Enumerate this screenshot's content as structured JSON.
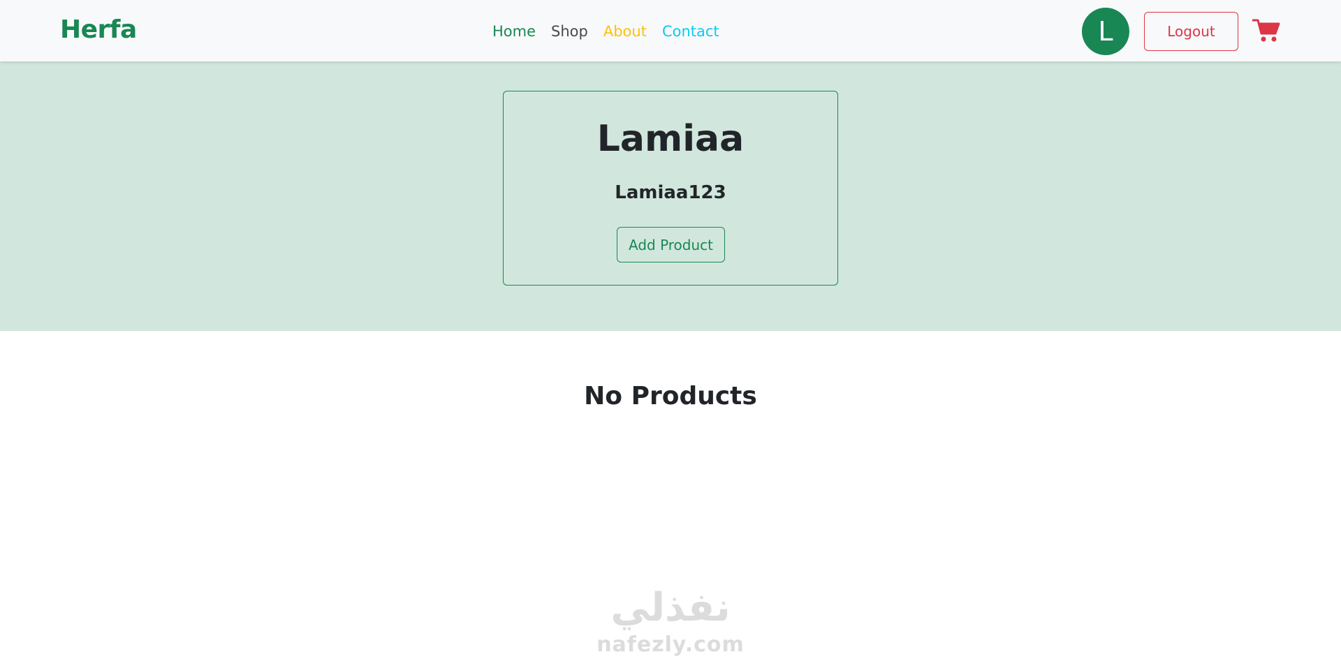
{
  "navbar": {
    "brand": "Herfa",
    "links": {
      "home": "Home",
      "shop": "Shop",
      "about": "About",
      "contact": "Contact"
    },
    "avatar_initial": "L",
    "logout_label": "Logout",
    "cart_icon": "shopping-cart-icon"
  },
  "profile": {
    "name": "Lamiaa",
    "username": "Lamiaa123",
    "add_product_label": "Add Product"
  },
  "products": {
    "empty_message": "No Products"
  },
  "watermark": {
    "arabic": "نفذلي",
    "latin": "nafezly.com"
  },
  "colors": {
    "brand_green": "#198754",
    "hero_bg": "#d1e7dd",
    "navbar_bg": "#f8f9fa",
    "logout_red": "#dc3545",
    "about_yellow": "#ffc107",
    "contact_cyan": "#0dcaf0"
  }
}
